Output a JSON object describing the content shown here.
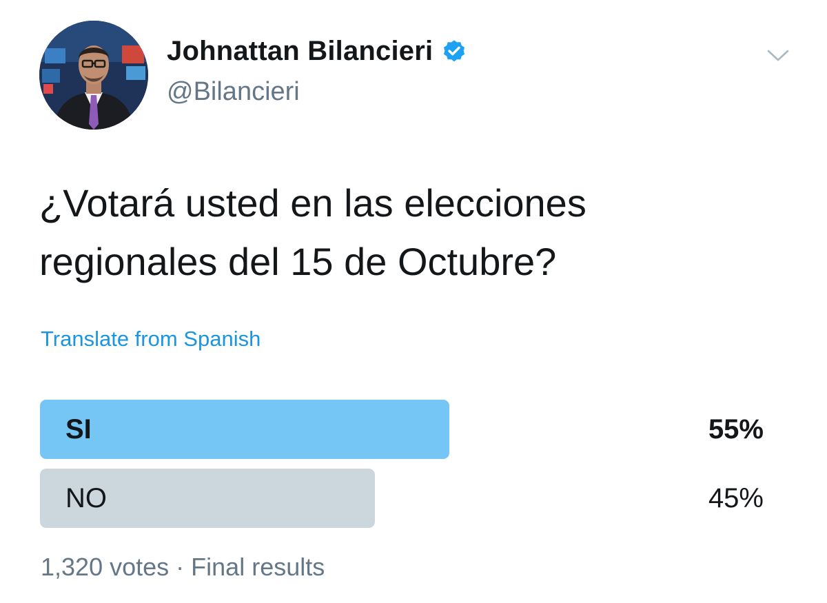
{
  "author": {
    "display_name": "Johnattan Bilancieri",
    "handle": "@Bilancieri",
    "verified": true,
    "verified_icon": "verified-badge-icon",
    "avatar": "profile-photo"
  },
  "menu": {
    "icon": "chevron-down-icon"
  },
  "tweet": {
    "text": "¿Votará usted en las elecciones regionales del 15 de Octubre?",
    "translate_label": "Translate from Spanish"
  },
  "poll": {
    "options": [
      {
        "label": "SI",
        "percent_text": "55%",
        "percent": 55,
        "winner": true
      },
      {
        "label": "NO",
        "percent_text": "45%",
        "percent": 45,
        "winner": false
      }
    ],
    "votes": "1,320 votes",
    "separator": "·",
    "status": "Final results"
  },
  "colors": {
    "link": "#1b95e0",
    "winner_bar": "#75c6f5",
    "other_bar": "#ccd6dd",
    "secondary_text": "#657786",
    "verified": "#1da1f2"
  }
}
